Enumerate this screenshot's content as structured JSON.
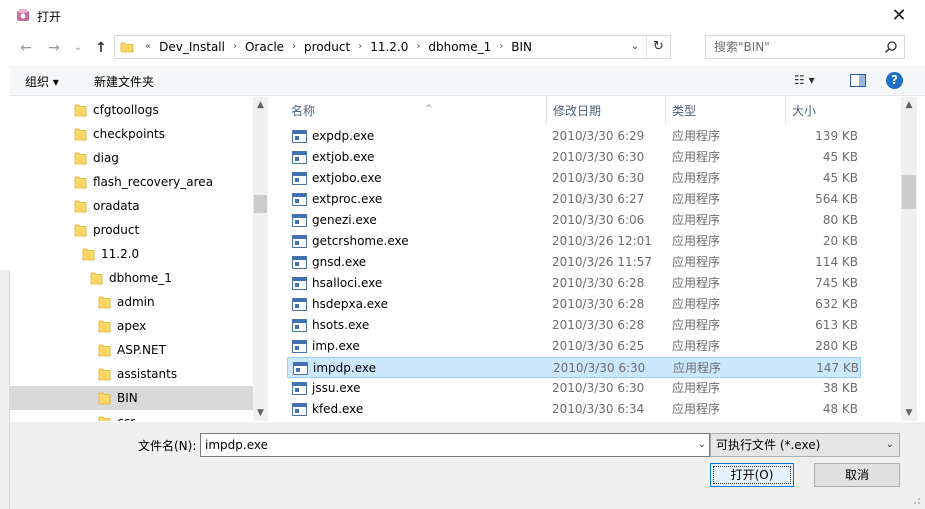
{
  "window": {
    "title": "打开",
    "close_glyph": "✕"
  },
  "nav": {
    "back_glyph": "←",
    "forward_glyph": "→",
    "history_glyph": "⌄",
    "up_glyph": "↑",
    "breadcrumb_lead": "«",
    "breadcrumbs": [
      "Dev_Install",
      "Oracle",
      "product",
      "11.2.0",
      "dbhome_1",
      "BIN"
    ],
    "search_placeholder": "搜索\"BIN\""
  },
  "toolbar": {
    "organize_label": "组织 ▾",
    "new_folder_label": "新建文件夹",
    "view_label": "☷ ▾"
  },
  "tree": {
    "items": [
      {
        "label": "cfgtoollogs",
        "level": 0
      },
      {
        "label": "checkpoints",
        "level": 0
      },
      {
        "label": "diag",
        "level": 0
      },
      {
        "label": "flash_recovery_area",
        "level": 0
      },
      {
        "label": "oradata",
        "level": 0
      },
      {
        "label": "product",
        "level": 0
      },
      {
        "label": "11.2.0",
        "level": 1
      },
      {
        "label": "dbhome_1",
        "level": 2
      },
      {
        "label": "admin",
        "level": 3
      },
      {
        "label": "apex",
        "level": 3
      },
      {
        "label": "ASP.NET",
        "level": 3
      },
      {
        "label": "assistants",
        "level": 3
      },
      {
        "label": "BIN",
        "level": 3,
        "selected": true
      },
      {
        "label": "ccr",
        "level": 3
      }
    ]
  },
  "columns": {
    "name": "名称",
    "date": "修改日期",
    "type": "类型",
    "size": "大小"
  },
  "files": [
    {
      "name": "expdp.exe",
      "date": "2010/3/30 6:29",
      "type": "应用程序",
      "size": "139 KB"
    },
    {
      "name": "extjob.exe",
      "date": "2010/3/30 6:30",
      "type": "应用程序",
      "size": "45 KB"
    },
    {
      "name": "extjobo.exe",
      "date": "2010/3/30 6:30",
      "type": "应用程序",
      "size": "45 KB"
    },
    {
      "name": "extproc.exe",
      "date": "2010/3/30 6:27",
      "type": "应用程序",
      "size": "564 KB"
    },
    {
      "name": "genezi.exe",
      "date": "2010/3/30 6:06",
      "type": "应用程序",
      "size": "80 KB"
    },
    {
      "name": "getcrshome.exe",
      "date": "2010/3/26 12:01",
      "type": "应用程序",
      "size": "20 KB"
    },
    {
      "name": "gnsd.exe",
      "date": "2010/3/26 11:57",
      "type": "应用程序",
      "size": "114 KB"
    },
    {
      "name": "hsalloci.exe",
      "date": "2010/3/30 6:28",
      "type": "应用程序",
      "size": "745 KB"
    },
    {
      "name": "hsdepxa.exe",
      "date": "2010/3/30 6:28",
      "type": "应用程序",
      "size": "632 KB"
    },
    {
      "name": "hsots.exe",
      "date": "2010/3/30 6:28",
      "type": "应用程序",
      "size": "613 KB"
    },
    {
      "name": "imp.exe",
      "date": "2010/3/30 6:25",
      "type": "应用程序",
      "size": "280 KB"
    },
    {
      "name": "impdp.exe",
      "date": "2010/3/30 6:30",
      "type": "应用程序",
      "size": "147 KB",
      "selected": true
    },
    {
      "name": "jssu.exe",
      "date": "2010/3/30 6:30",
      "type": "应用程序",
      "size": "38 KB"
    },
    {
      "name": "kfed.exe",
      "date": "2010/3/30 6:34",
      "type": "应用程序",
      "size": "48 KB"
    }
  ],
  "bottom": {
    "filename_label": "文件名(N):",
    "filename_value": "impdp.exe",
    "filetype_value": "可执行文件 (*.exe)",
    "open_label": "打开(O)",
    "cancel_label": "取消"
  },
  "colors": {
    "selection_bg": "#cce8ff",
    "selection_border": "#99d1ff",
    "tree_selection": "#d9d9d9",
    "folder": "#ffd766",
    "help_blue": "#1e6fc7"
  }
}
